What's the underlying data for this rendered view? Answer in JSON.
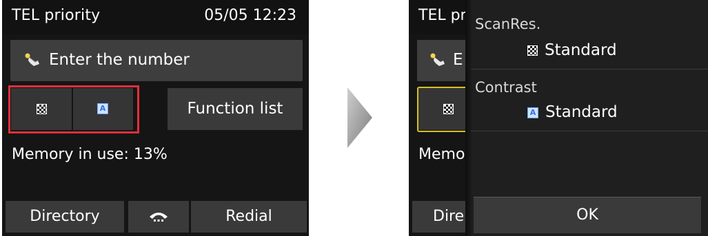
{
  "left_screen": {
    "title": "TEL priority",
    "datetime": "05/05 12:23",
    "number_field_placeholder": "Enter the number",
    "function_list_label": "Function list",
    "memory_status": "Memory in use: 13%",
    "directory_label": "Directory",
    "redial_label": "Redial",
    "icons": [
      "hand-pointer-icon",
      "scan-resolution-icon",
      "contrast-icon",
      "hook-icon"
    ],
    "highlight_color": "#e0303a"
  },
  "right_screen": {
    "scanres_label": "ScanRes.",
    "scanres_value": "Standard",
    "contrast_label": "Contrast",
    "contrast_value": "Standard",
    "ok_label": "OK",
    "title_partial": "TEL pr",
    "field_partial": "E",
    "memory_partial": "Memo",
    "directory_partial": "Dire",
    "focus_color": "#d8c020"
  }
}
